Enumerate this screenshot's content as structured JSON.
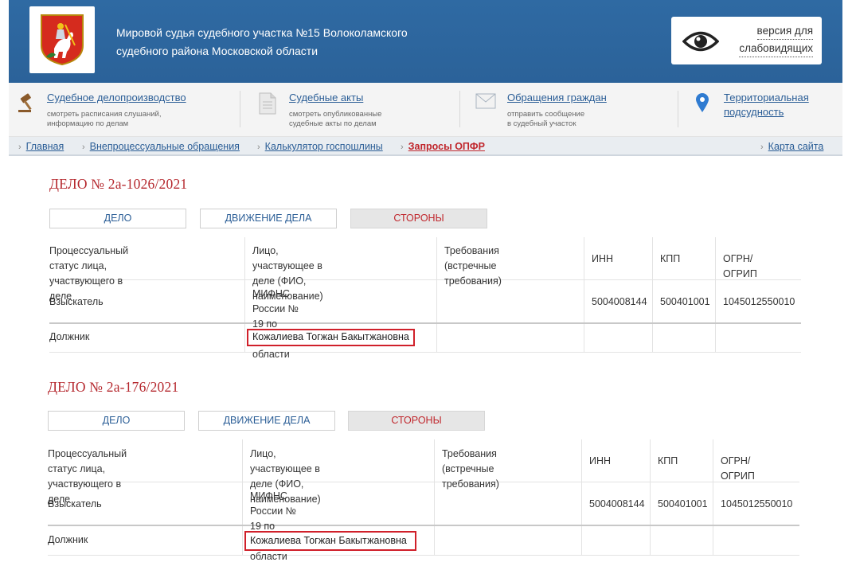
{
  "header": {
    "court_line1": "Мировой судья судебного участка №15 Волоколамского",
    "court_line2": "судебного района Московской области",
    "vision_line1": "версия для",
    "vision_line2": "слабовидящих",
    "vision_icon": "eye-icon",
    "logo_icon": "moscow-region-coat-of-arms"
  },
  "quicknav": [
    {
      "icon": "gavel-icon",
      "title": "Судебное делопроизводство",
      "desc1": "смотреть расписания слушаний,",
      "desc2": "информацию по делам"
    },
    {
      "icon": "document-icon",
      "title": "Судебные акты",
      "desc1": "смотреть опубликованные",
      "desc2": "судебные акты по делам"
    },
    {
      "icon": "envelope-icon",
      "title": "Обращения граждан",
      "desc1": "отправить сообщение",
      "desc2": "в судебный участок"
    },
    {
      "icon": "map-pin-icon",
      "title": "Территориальная",
      "title2": "подсудность"
    }
  ],
  "breadcrumb": {
    "items": [
      "Главная",
      "Внепроцессуальные обращения",
      "Калькулятор госпошлины",
      "Запросы ОПФР"
    ],
    "sitemap": "Карта сайта"
  },
  "colors": {
    "header_blue": "#2f6aa3",
    "accent_red": "#b5282e",
    "link_blue": "#2a5d96",
    "highlight_red": "#d0202a"
  },
  "cases": [
    {
      "title": "ДЕЛО № 2а-1026/2021",
      "tabs": [
        "ДЕЛО",
        "ДВИЖЕНИЕ ДЕЛА",
        "СТОРОНЫ"
      ],
      "active_tab": "СТОРОНЫ",
      "headers": {
        "status1": "Процессуальный статус лица,",
        "status2": "участвующего в деле",
        "person1": "Лицо, участвующее в деле (ФИО,",
        "person2": "наименование)",
        "req1": "Требования (встречные",
        "req2": "требования)",
        "inn": "ИНН",
        "kpp": "КПП",
        "ogrn": "ОГРН/ОГРИП"
      },
      "rows": [
        {
          "status": "Взыскатель",
          "person1": "МИФНС России № 19 по Московской",
          "person2": "области",
          "inn": "5004008144",
          "kpp": "500401001",
          "ogrn": "1045012550010"
        },
        {
          "status": "Должник",
          "person": "Кожалиева Тогжан Бакытжановна"
        }
      ]
    },
    {
      "title": "ДЕЛО № 2а-176/2021",
      "tabs": [
        "ДЕЛО",
        "ДВИЖЕНИЕ ДЕЛА",
        "СТОРОНЫ"
      ],
      "active_tab": "СТОРОНЫ",
      "headers": {
        "status1": "Процессуальный статус лица,",
        "status2": "участвующего в деле",
        "person1": "Лицо, участвующее в деле (ФИО,",
        "person2": "наименование)",
        "req1": "Требования (встречные",
        "req2": "требования)",
        "inn": "ИНН",
        "kpp": "КПП",
        "ogrn": "ОГРН/ОГРИП"
      },
      "rows": [
        {
          "status": "Взыскатель",
          "person1": "МИФНС России № 19 по Московской",
          "person2": "области",
          "inn": "5004008144",
          "kpp": "500401001",
          "ogrn": "1045012550010"
        },
        {
          "status": "Должник",
          "person": "Кожалиева Тогжан Бакытжановна"
        }
      ]
    }
  ]
}
